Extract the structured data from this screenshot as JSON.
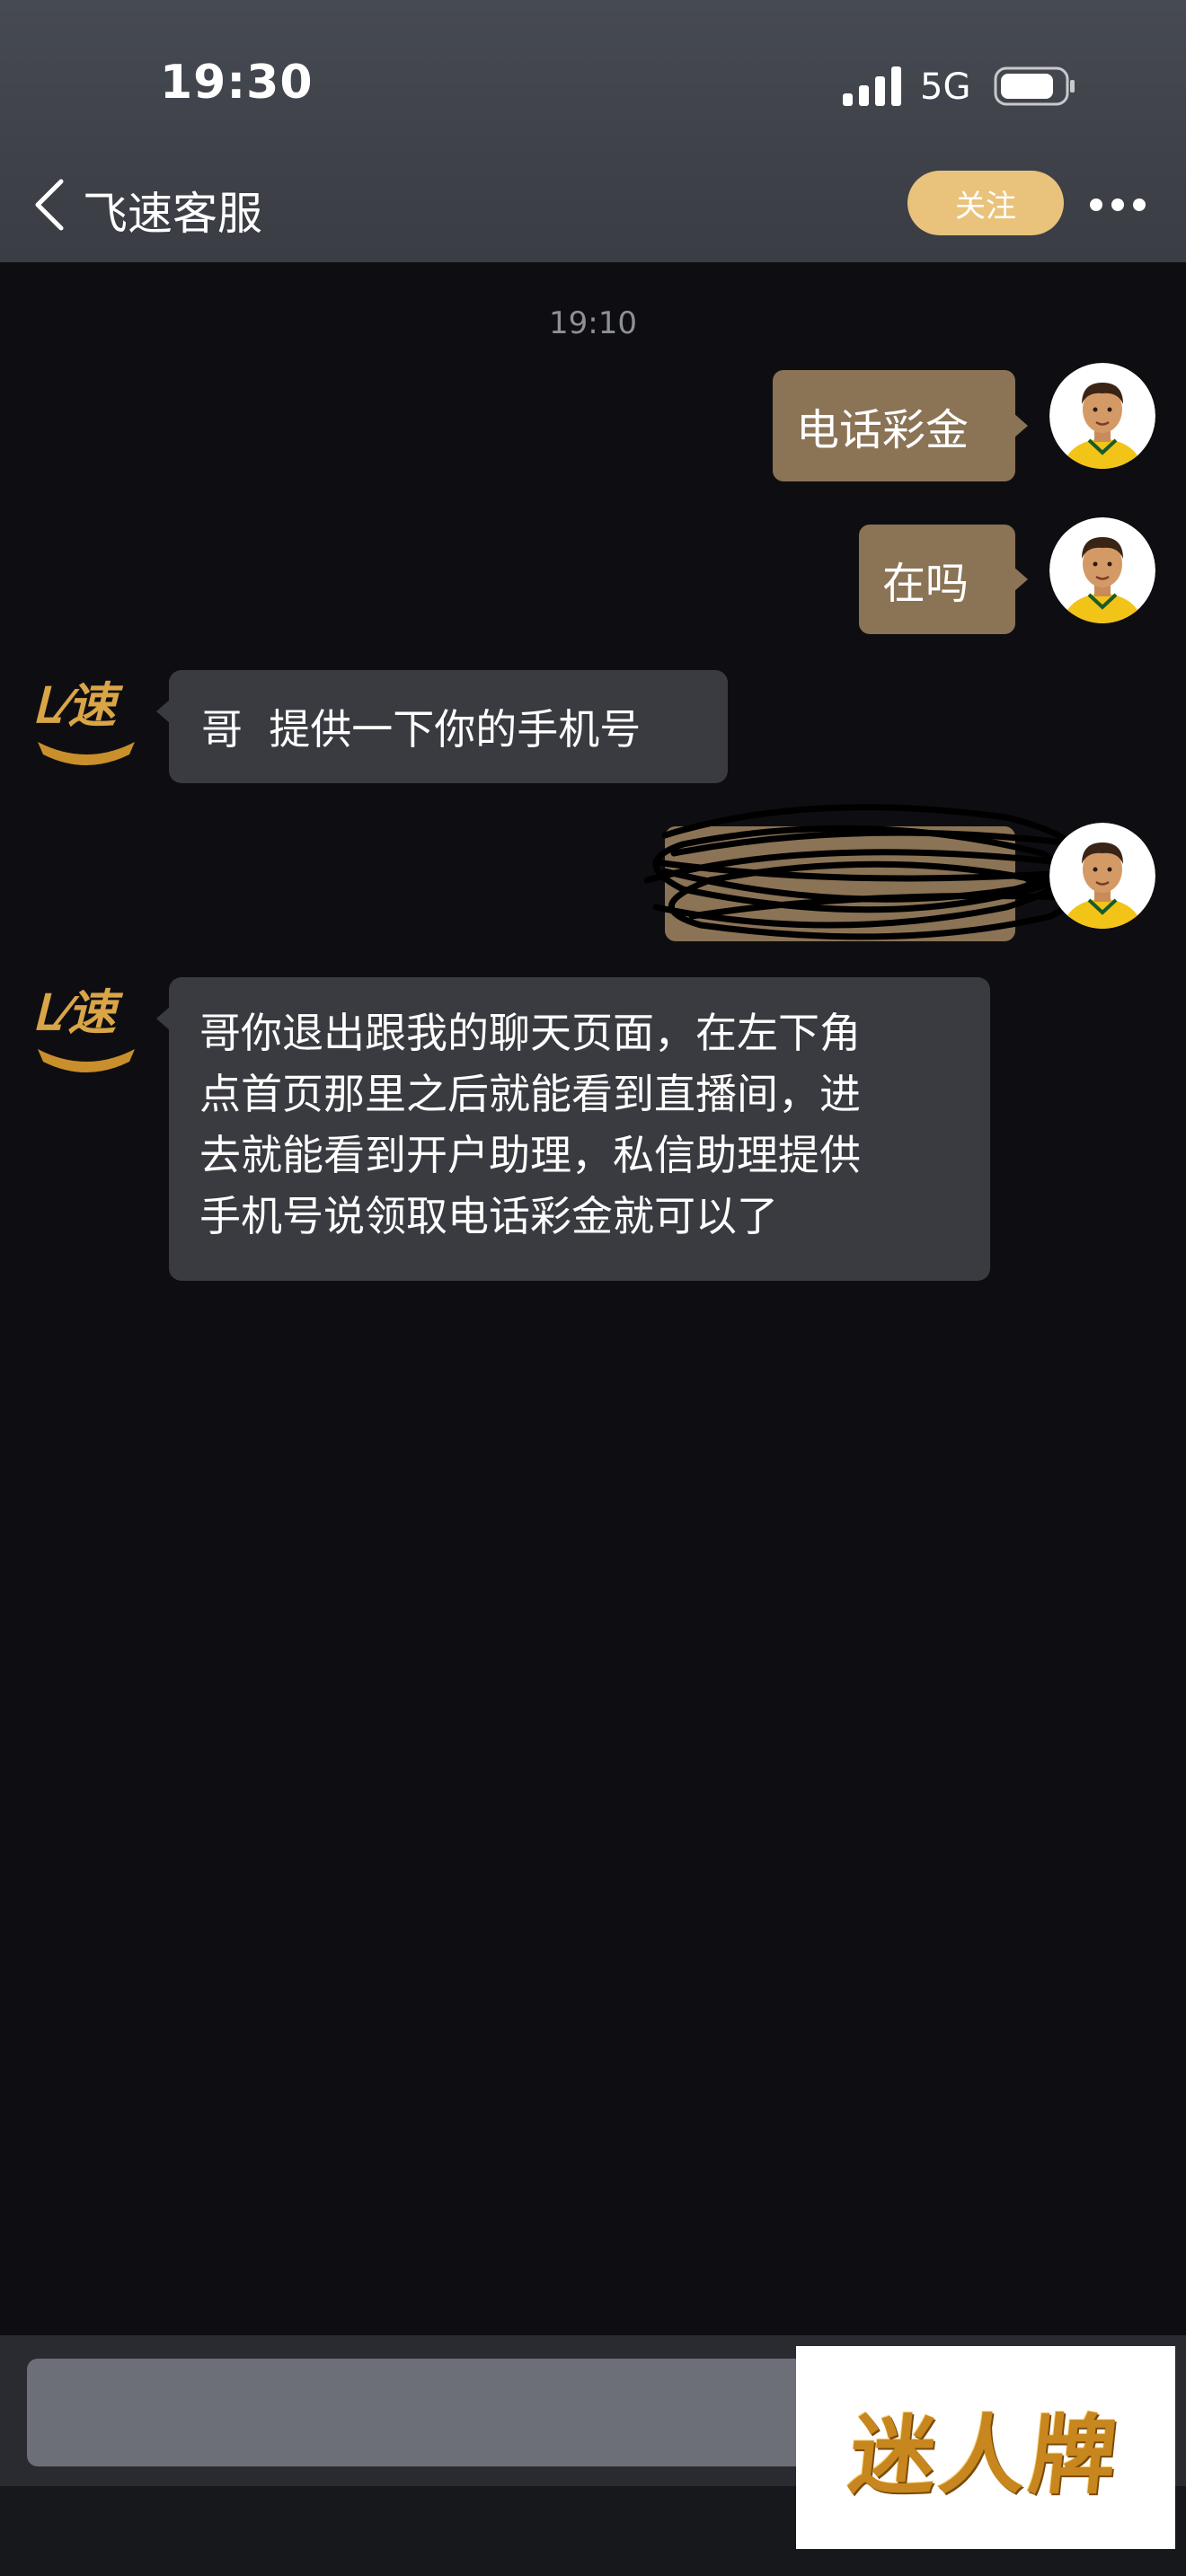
{
  "status_bar": {
    "time": "19:30",
    "network": "5G"
  },
  "header": {
    "back_icon": "chevron-left-icon",
    "title": "飞速客服",
    "follow_label": "关注",
    "more_icon": "more-dots-icon"
  },
  "chat": {
    "timestamp": "19:10",
    "messages": [
      {
        "from": "me",
        "text": "电话彩金"
      },
      {
        "from": "me",
        "text": "在吗"
      },
      {
        "from": "agent",
        "text": "哥  提供一下你的手机号"
      },
      {
        "from": "me",
        "text": "",
        "redacted": true
      },
      {
        "from": "agent",
        "lines": [
          "哥你退出跟我的聊天页面，在左下角",
          "点首页那里之后就能看到直播间，进",
          "去就能看到开户助理，私信助理提供",
          "手机号说领取电话彩金就可以了"
        ]
      }
    ]
  },
  "watermark": {
    "text": "迷人牌"
  },
  "colors": {
    "follow_button": "#e9c37c",
    "outgoing_bubble": "#8b7356",
    "incoming_bubble": "#3a3b40",
    "background": "#0e0e12"
  }
}
